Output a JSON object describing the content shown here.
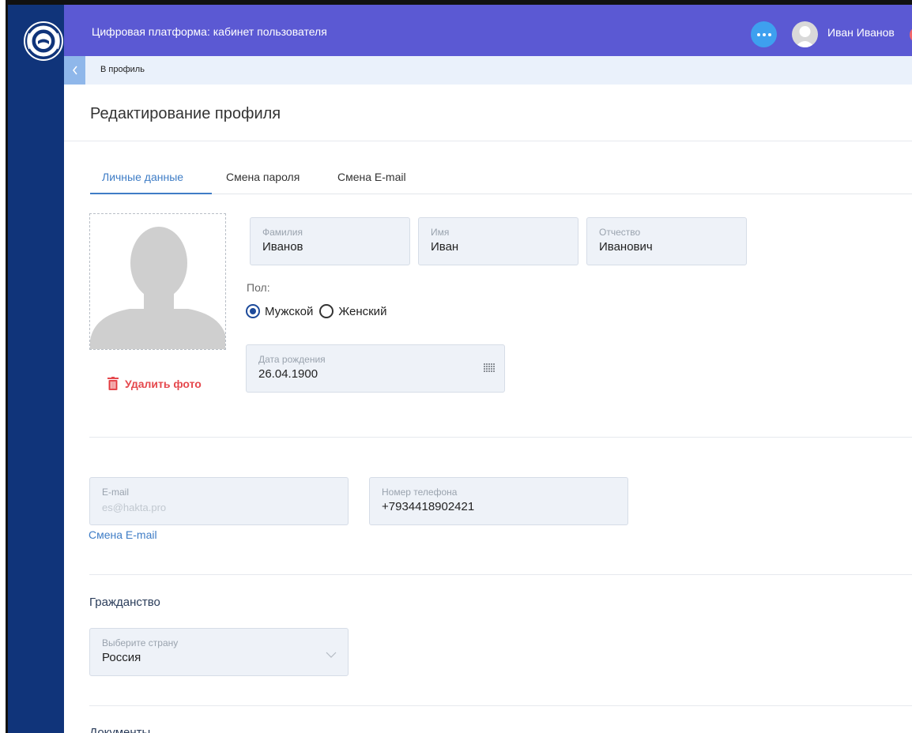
{
  "header": {
    "app_title": "Цифровая платформа: кабинет пользователя",
    "user_name": "Иван Иванов"
  },
  "breadcrumb": {
    "back_icon": "chevron-left-icon",
    "label": "В профиль"
  },
  "page": {
    "title": "Редактирование профиля"
  },
  "tabs": [
    {
      "label": "Личные данные",
      "active": true
    },
    {
      "label": "Смена пароля",
      "active": false
    },
    {
      "label": "Смена E-mail",
      "active": false
    }
  ],
  "photo": {
    "delete_label": "Удалить фото",
    "delete_icon": "trash-icon"
  },
  "name_fields": {
    "last_name": {
      "label": "Фамилия",
      "value": "Иванов"
    },
    "first_name": {
      "label": "Имя",
      "value": "Иван"
    },
    "patronymic": {
      "label": "Отчество",
      "value": "Иванович"
    }
  },
  "gender": {
    "label": "Пол:",
    "options": [
      {
        "label": "Мужской",
        "selected": true
      },
      {
        "label": "Женский",
        "selected": false
      }
    ]
  },
  "birth_date": {
    "label": "Дата рождения",
    "value": "26.04.1900",
    "icon": "calendar-icon"
  },
  "contacts": {
    "email": {
      "label": "E-mail",
      "value": "es@hakta.pro"
    },
    "phone": {
      "label": "Номер телефона",
      "value": "+7934418902421"
    },
    "change_email_link": "Смена E-mail"
  },
  "citizenship": {
    "title": "Гражданство",
    "country_select": {
      "label": "Выберите страну",
      "value": "Россия",
      "icon": "chevron-down-icon"
    }
  },
  "documents": {
    "title": "Документы"
  },
  "colors": {
    "topbar": "#5b59d3",
    "sidebar": "#10347a",
    "accent": "#3f7dc6",
    "danger": "#e5484d",
    "field_bg": "#eef2f8"
  }
}
